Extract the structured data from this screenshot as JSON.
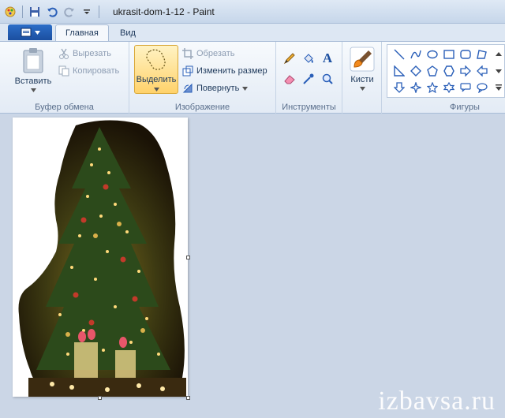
{
  "window": {
    "title": "ukrasit-dom-1-12 - Paint"
  },
  "quick_access": {
    "icons": [
      "paint-app-icon",
      "save-icon",
      "undo-icon",
      "redo-icon",
      "customize-dropdown-icon"
    ]
  },
  "tabs": {
    "home": "Главная",
    "view": "Вид"
  },
  "clipboard": {
    "paste_label": "Вставить",
    "cut_label": "Вырезать",
    "copy_label": "Копировать",
    "group_label": "Буфер обмена"
  },
  "image": {
    "select_label": "Выделить",
    "crop_label": "Обрезать",
    "resize_label": "Изменить размер",
    "rotate_label": "Повернуть",
    "group_label": "Изображение"
  },
  "tools": {
    "group_label": "Инструменты",
    "items": [
      "pencil-icon",
      "fill-icon",
      "text-icon",
      "eraser-icon",
      "color-picker-icon",
      "magnifier-icon"
    ],
    "text_glyph": "A"
  },
  "brushes": {
    "label": "Кисти"
  },
  "shapes": {
    "group_label": "Фигуры"
  },
  "watermark": {
    "text": "izbavsa.ru"
  },
  "colors": {
    "accent": "#1b4fa0",
    "selected_bg": "#ffd26b",
    "workspace": "#cbd6e6"
  }
}
